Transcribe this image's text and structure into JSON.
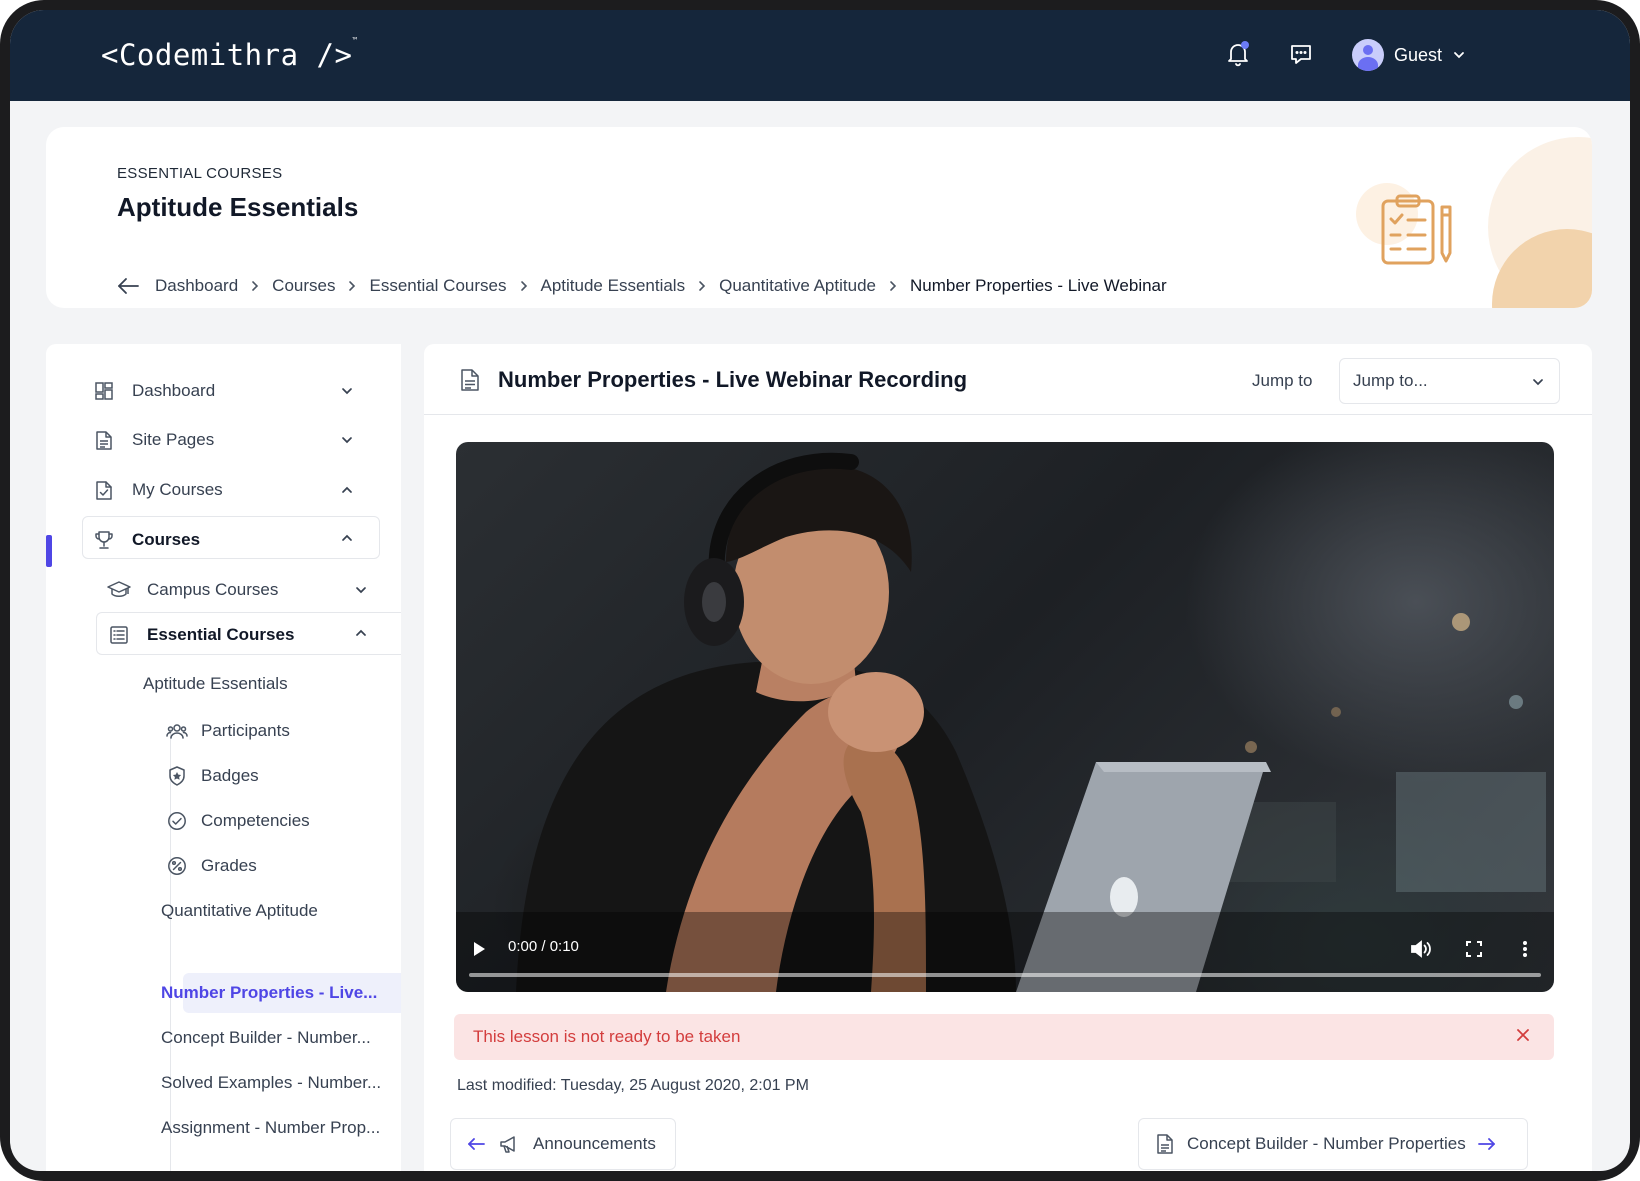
{
  "app": {
    "logo_text": "<Codemithra />",
    "logo_tm": "™",
    "user_name": "Guest"
  },
  "header": {
    "eyebrow": "ESSENTIAL COURSES",
    "title": "Aptitude Essentials",
    "breadcrumb": [
      "Dashboard",
      "Courses",
      "Essential Courses",
      "Aptitude Essentials",
      "Quantitative Aptitude",
      "Number Properties - Live Webinar"
    ]
  },
  "sidebar": {
    "items": [
      {
        "label": "Dashboard",
        "icon": "dashboard-icon",
        "expanded": false
      },
      {
        "label": "Site Pages",
        "icon": "document-icon",
        "expanded": false
      },
      {
        "label": "My Courses",
        "icon": "file-check-icon",
        "expanded": true
      },
      {
        "label": "Courses",
        "icon": "trophy-icon",
        "expanded": true,
        "active": true
      }
    ],
    "sub_items": [
      {
        "label": "Campus Courses",
        "icon": "graduation-cap-icon",
        "expanded": false
      },
      {
        "label": "Essential Courses",
        "icon": "list-icon",
        "expanded": true
      }
    ],
    "course_title": "Aptitude Essentials",
    "course_links": [
      {
        "label": "Participants",
        "icon": "users-icon"
      },
      {
        "label": "Badges",
        "icon": "badge-icon"
      },
      {
        "label": "Competencies",
        "icon": "check-circle-icon"
      },
      {
        "label": "Grades",
        "icon": "percent-icon"
      }
    ],
    "section_title": "Quantitative Aptitude",
    "lessons": [
      {
        "label": "Number Properties - Live...",
        "selected": true
      },
      {
        "label": "Concept Builder - Number..."
      },
      {
        "label": "Solved Examples - Number..."
      },
      {
        "label": "Assignment - Number Prop..."
      }
    ]
  },
  "main": {
    "title": "Number Properties - Live Webinar Recording",
    "jump_label": "Jump to",
    "jump_placeholder": "Jump to...",
    "video": {
      "time": "0:00 / 0:10",
      "progress": 0
    },
    "alert": "This lesson is not ready to be taken",
    "last_modified": "Last modified: Tuesday, 25 August 2020, 2:01 PM",
    "prev_label": "Announcements",
    "next_label": "Concept Builder - Number Properties"
  },
  "colors": {
    "topbar": "#15263b",
    "accent": "#4f46e5",
    "alert_bg": "#fbe4e4",
    "alert_text": "#d33d3d",
    "decor": "#f2d3ac"
  }
}
